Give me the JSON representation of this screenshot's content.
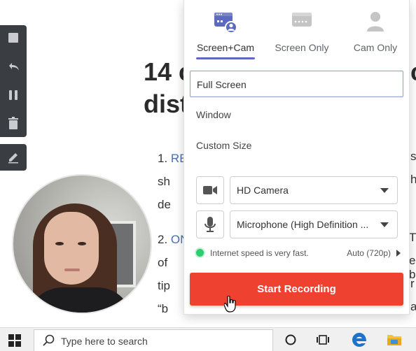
{
  "article": {
    "heading_line1": "14 c",
    "heading_line1_right": "ce",
    "heading_line2": "dist",
    "item1_num": "1.",
    "item1_link": "RE",
    "item1_right": "s",
    "item1_line2": "sh",
    "item1_line2_right": "he",
    "item1_line3": "de",
    "item2_num": "2.",
    "item2_link": "ON",
    "item2_right": "Th",
    "item2_line2": "of",
    "item2_line2_right": "e b",
    "item2_line3": "tip",
    "item2_line3_right": "r",
    "item2_line4": "“b",
    "item2_line4_right": "a"
  },
  "popup": {
    "modes": [
      {
        "label": "Screen+Cam",
        "icon": "screen-cam-icon",
        "active": true
      },
      {
        "label": "Screen Only",
        "icon": "screen-only-icon",
        "active": false
      },
      {
        "label": "Cam Only",
        "icon": "cam-only-icon",
        "active": false
      }
    ],
    "capture_options": [
      "Full Screen",
      "Window",
      "Custom Size"
    ],
    "selected_option": "Full Screen",
    "camera": {
      "icon": "video-camera-icon",
      "value": "HD Camera"
    },
    "microphone": {
      "icon": "microphone-icon",
      "value": "Microphone (High Definition ..."
    },
    "status": {
      "text": "Internet speed is very fast.",
      "quality": "Auto (720p)"
    },
    "start_button": "Start Recording"
  },
  "taskbar": {
    "search_placeholder": "Type here to search"
  },
  "colors": {
    "accent": "#5c6bc0",
    "start_button": "#ef4130",
    "status_ok": "#2ecc71",
    "toolbar": "#3a3d42"
  }
}
